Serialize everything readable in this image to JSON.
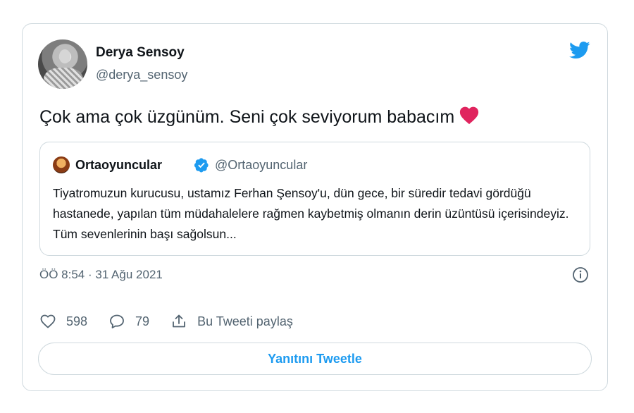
{
  "author": {
    "name": "Derya Sensoy",
    "handle": "@derya_sensoy"
  },
  "tweet": {
    "text": "Çok ama çok üzgünüm. Seni çok seviyorum babacım"
  },
  "quoted": {
    "name": "Ortaoyuncular",
    "handle": "@Ortaoyuncular",
    "text": "Tiyatromuzun kurucusu, ustamız Ferhan Şensoy'u, dün gece, bir süredir tedavi gördüğü hastanede, yapılan tüm müdahalelere rağmen kaybetmiş olmanın derin üzüntüsü içerisindeyiz. Tüm sevenlerinin başı sağolsun..."
  },
  "meta": {
    "timestamp": "ÖÖ 8:54 · 31 Ağu 2021"
  },
  "actions": {
    "likes": "598",
    "replies": "79",
    "share_label": "Bu Tweeti paylaş"
  },
  "reply_button": {
    "label": "Yanıtını Tweetle"
  },
  "colors": {
    "twitter_blue": "#1d9bf0",
    "heart_red": "#e0245e",
    "muted": "#536471",
    "border": "#cfd9de"
  },
  "icons": [
    "twitter-bird-icon",
    "heart-emoji-icon",
    "verified-badge-icon",
    "info-icon",
    "like-icon",
    "reply-icon",
    "share-icon"
  ]
}
